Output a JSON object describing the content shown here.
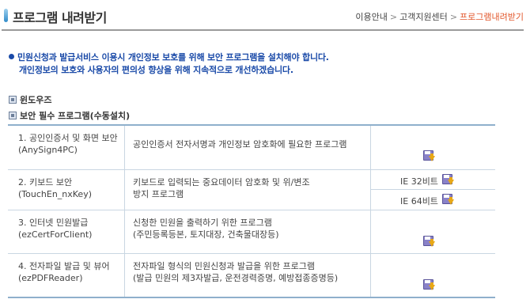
{
  "header": {
    "title": "프로그램 내려받기",
    "breadcrumb": [
      "이용안내",
      "고객지원센터",
      "프로그램내려받기"
    ],
    "breadcrumb_sep": ">",
    "accent_color": "#e2572b"
  },
  "notice": {
    "line1": "민원신청과 발급서비스 이용시 개인정보 보호를 위해 보안 프로그램을 설치해야 합니다.",
    "line2": "개인정보의 보호와 사용자의 편의성 향상을 위해 지속적으로 개선하겠습니다.",
    "color": "#1a4aa8"
  },
  "sections": {
    "os": "윈도우즈",
    "required": "보안 필수 프로그램(수동설치)"
  },
  "programs": [
    {
      "name": "1. 공인인증서 및 화면 보안",
      "module": "(AnySign4PC)",
      "desc1": "공인인증서 전자서명과 개인정보 암호화에 필요한 프로그램",
      "desc2": "",
      "download_icon": "download-icon"
    },
    {
      "name": "2. 키보드 보안",
      "module": "(TouchEn_nxKey)",
      "desc1": "키보드로 입력되는 중요데이터 암호화 및 위/변조",
      "desc2": "방지 프로그램",
      "variants": [
        "IE 32비트",
        "IE 64비트"
      ],
      "download_icon": "download-icon"
    },
    {
      "name": "3. 인터넷 민원발급",
      "module": "(ezCertForClient)",
      "desc1": "신청한 민원을 출력하기 위한 프로그램",
      "desc2": "(주민등록등본, 토지대장, 건축물대장등)",
      "download_icon": "download-icon"
    },
    {
      "name": "4. 전자파일 발급 및 뷰어",
      "module": "(ezPDFReader)",
      "desc1": "전자파일 형식의 민원신청과 발급을 위한 프로그램",
      "desc2": "(발급 민원의 제3자발급, 운전경력증명, 예방접종증명등)",
      "download_icon": "download-icon"
    }
  ]
}
